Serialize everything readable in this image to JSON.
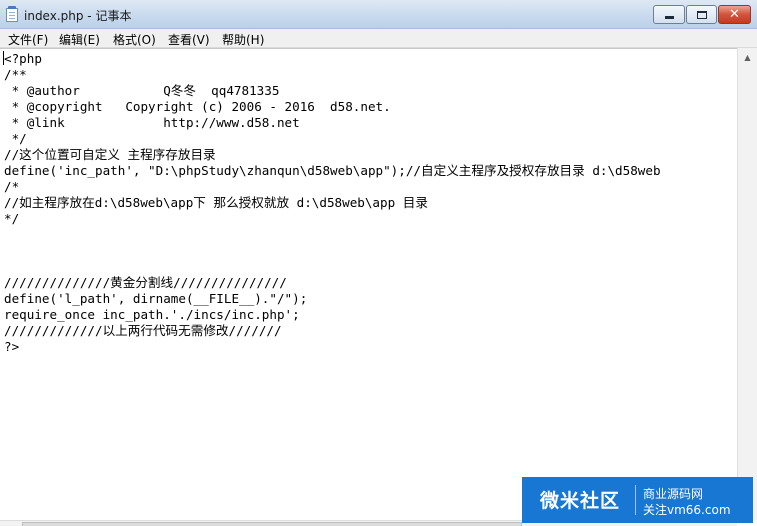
{
  "window": {
    "title": "index.php - 记事本",
    "icon": "notepad-icon",
    "controls": {
      "minimize": "minimize-icon",
      "maximize": "maximize-icon",
      "close_glyph": "✕"
    }
  },
  "menu": {
    "items": [
      {
        "label": "文件(F)"
      },
      {
        "label": "编辑(E)"
      },
      {
        "label": "格式(O)"
      },
      {
        "label": "查看(V)"
      },
      {
        "label": "帮助(H)"
      }
    ]
  },
  "editor": {
    "lines": [
      "<?php",
      "/**",
      " * @author           Q冬冬  qq4781335",
      " * @copyright   Copyright (c) 2006 - 2016  d58.net.",
      " * @link             http://www.d58.net",
      " */",
      "//这个位置可自定义 主程序存放目录",
      "define('inc_path', \"D:\\phpStudy\\zhanqun\\d58web\\app\");//自定义主程序及授权存放目录 d:\\d58web",
      "/*",
      "//如主程序放在d:\\d58web\\app下 那么授权就放 d:\\d58web\\app 目录",
      "*/",
      "",
      "",
      "",
      "//////////////黄金分割线///////////////",
      "define('l_path', dirname(__FILE__).\"/\");",
      "require_once inc_path.'./incs/inc.php';",
      "/////////////以上两行代码无需修改///////",
      "?>"
    ]
  },
  "scrollbar": {
    "up_arrow": "▲"
  },
  "watermark": {
    "name": "微米社区",
    "line1": "商业源码网",
    "line2": "关注vm66.com"
  }
}
